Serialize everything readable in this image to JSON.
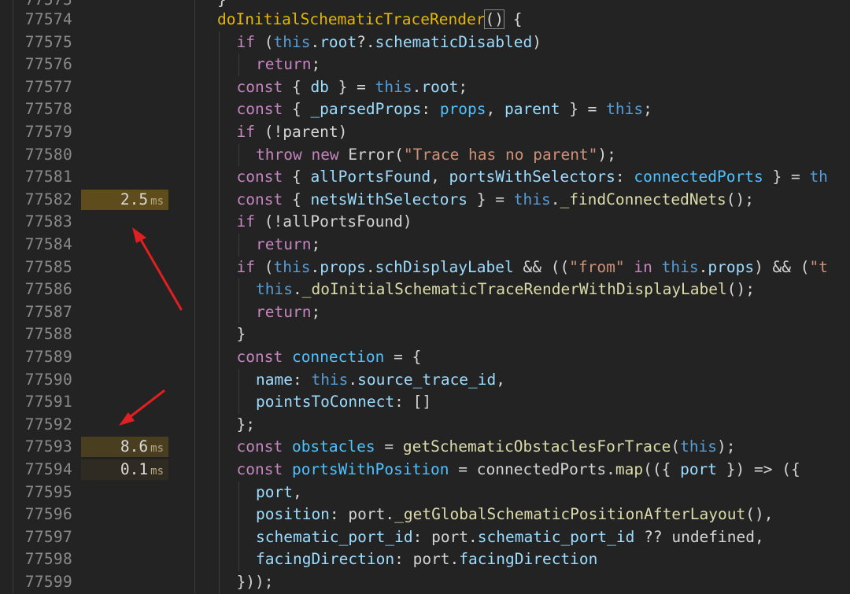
{
  "editor": {
    "top_partial_line_number": "77573",
    "lines": [
      {
        "n": "77574",
        "timing": null,
        "indent": 0,
        "tokens": [
          [
            "t-fnyellow",
            "doInitialSchematicTraceRender"
          ],
          [
            "t-plain cursor-box",
            "()"
          ],
          [
            "t-plain",
            " {"
          ]
        ]
      },
      {
        "n": "77575",
        "timing": null,
        "indent": 1,
        "tokens": [
          [
            "t-kw",
            "if"
          ],
          [
            "t-plain",
            " ("
          ],
          [
            "t-this",
            "this"
          ],
          [
            "t-plain",
            "."
          ],
          [
            "t-var",
            "root"
          ],
          [
            "t-plain",
            "?."
          ],
          [
            "t-var",
            "schematicDisabled"
          ],
          [
            "t-plain",
            ")"
          ]
        ]
      },
      {
        "n": "77576",
        "timing": null,
        "indent": 2,
        "tokens": [
          [
            "t-kw",
            "return"
          ],
          [
            "t-plain",
            ";"
          ]
        ]
      },
      {
        "n": "77577",
        "timing": null,
        "indent": 1,
        "tokens": [
          [
            "t-kw",
            "const"
          ],
          [
            "t-plain",
            " { "
          ],
          [
            "t-var",
            "db"
          ],
          [
            "t-plain",
            " } = "
          ],
          [
            "t-this",
            "this"
          ],
          [
            "t-plain",
            "."
          ],
          [
            "t-var",
            "root"
          ],
          [
            "t-plain",
            ";"
          ]
        ]
      },
      {
        "n": "77578",
        "timing": null,
        "indent": 1,
        "tokens": [
          [
            "t-kw",
            "const"
          ],
          [
            "t-plain",
            " { "
          ],
          [
            "t-var",
            "_parsedProps"
          ],
          [
            "t-plain",
            ": "
          ],
          [
            "t-const",
            "props"
          ],
          [
            "t-plain",
            ", "
          ],
          [
            "t-var",
            "parent"
          ],
          [
            "t-plain",
            " } = "
          ],
          [
            "t-this",
            "this"
          ],
          [
            "t-plain",
            ";"
          ]
        ]
      },
      {
        "n": "77579",
        "timing": null,
        "indent": 1,
        "tokens": [
          [
            "t-kw",
            "if"
          ],
          [
            "t-plain",
            " (!parent)"
          ]
        ]
      },
      {
        "n": "77580",
        "timing": null,
        "indent": 2,
        "tokens": [
          [
            "t-kw",
            "throw"
          ],
          [
            "t-plain",
            " "
          ],
          [
            "t-kw",
            "new"
          ],
          [
            "t-plain",
            " Error("
          ],
          [
            "t-str",
            "\"Trace has no parent\""
          ],
          [
            "t-plain",
            ");"
          ]
        ]
      },
      {
        "n": "77581",
        "timing": null,
        "indent": 1,
        "tokens": [
          [
            "t-kw",
            "const"
          ],
          [
            "t-plain",
            " { "
          ],
          [
            "t-var",
            "allPortsFound"
          ],
          [
            "t-plain",
            ", "
          ],
          [
            "t-var",
            "portsWithSelectors"
          ],
          [
            "t-plain",
            ": "
          ],
          [
            "t-const",
            "connectedPorts"
          ],
          [
            "t-plain",
            " } = "
          ],
          [
            "t-this",
            "th"
          ]
        ]
      },
      {
        "n": "77582",
        "timing": {
          "value": "2.5",
          "unit": "ms",
          "level": "hot"
        },
        "indent": 1,
        "tokens": [
          [
            "t-kw",
            "const"
          ],
          [
            "t-plain",
            " { "
          ],
          [
            "t-var",
            "netsWithSelectors"
          ],
          [
            "t-plain",
            " } = "
          ],
          [
            "t-this",
            "this"
          ],
          [
            "t-plain",
            "."
          ],
          [
            "t-fn",
            "_findConnectedNets"
          ],
          [
            "t-plain",
            "();"
          ]
        ]
      },
      {
        "n": "77583",
        "timing": null,
        "indent": 1,
        "tokens": [
          [
            "t-kw",
            "if"
          ],
          [
            "t-plain",
            " (!allPortsFound)"
          ]
        ]
      },
      {
        "n": "77584",
        "timing": null,
        "indent": 2,
        "tokens": [
          [
            "t-kw",
            "return"
          ],
          [
            "t-plain",
            ";"
          ]
        ]
      },
      {
        "n": "77585",
        "timing": null,
        "indent": 1,
        "tokens": [
          [
            "t-kw",
            "if"
          ],
          [
            "t-plain",
            " ("
          ],
          [
            "t-this",
            "this"
          ],
          [
            "t-plain",
            "."
          ],
          [
            "t-var",
            "props"
          ],
          [
            "t-plain",
            "."
          ],
          [
            "t-var",
            "schDisplayLabel"
          ],
          [
            "t-plain",
            " && (("
          ],
          [
            "t-str",
            "\"from\""
          ],
          [
            "t-plain",
            " "
          ],
          [
            "t-kw",
            "in"
          ],
          [
            "t-plain",
            " "
          ],
          [
            "t-this",
            "this"
          ],
          [
            "t-plain",
            "."
          ],
          [
            "t-var",
            "props"
          ],
          [
            "t-plain",
            ") && ("
          ],
          [
            "t-str",
            "\"t"
          ]
        ]
      },
      {
        "n": "77586",
        "timing": null,
        "indent": 2,
        "tokens": [
          [
            "t-this",
            "this"
          ],
          [
            "t-plain",
            "."
          ],
          [
            "t-fn",
            "_doInitialSchematicTraceRenderWithDisplayLabel"
          ],
          [
            "t-plain",
            "();"
          ]
        ]
      },
      {
        "n": "77587",
        "timing": null,
        "indent": 2,
        "tokens": [
          [
            "t-kw",
            "return"
          ],
          [
            "t-plain",
            ";"
          ]
        ]
      },
      {
        "n": "77588",
        "timing": null,
        "indent": 1,
        "tokens": [
          [
            "t-plain",
            "}"
          ]
        ]
      },
      {
        "n": "77589",
        "timing": null,
        "indent": 1,
        "tokens": [
          [
            "t-kw",
            "const"
          ],
          [
            "t-plain",
            " "
          ],
          [
            "t-const",
            "connection"
          ],
          [
            "t-plain",
            " = {"
          ]
        ]
      },
      {
        "n": "77590",
        "timing": null,
        "indent": 2,
        "tokens": [
          [
            "t-var",
            "name"
          ],
          [
            "t-plain",
            ": "
          ],
          [
            "t-this",
            "this"
          ],
          [
            "t-plain",
            "."
          ],
          [
            "t-var",
            "source_trace_id"
          ],
          [
            "t-plain",
            ","
          ]
        ]
      },
      {
        "n": "77591",
        "timing": null,
        "indent": 2,
        "tokens": [
          [
            "t-var",
            "pointsToConnect"
          ],
          [
            "t-plain",
            ": []"
          ]
        ]
      },
      {
        "n": "77592",
        "timing": null,
        "indent": 1,
        "tokens": [
          [
            "t-plain",
            "};"
          ]
        ]
      },
      {
        "n": "77593",
        "timing": {
          "value": "8.6",
          "unit": "ms",
          "level": "warm"
        },
        "indent": 1,
        "tokens": [
          [
            "t-kw",
            "const"
          ],
          [
            "t-plain",
            " "
          ],
          [
            "t-const",
            "obstacles"
          ],
          [
            "t-plain",
            " = "
          ],
          [
            "t-fn",
            "getSchematicObstaclesForTrace"
          ],
          [
            "t-plain",
            "("
          ],
          [
            "t-this",
            "this"
          ],
          [
            "t-plain",
            ");"
          ]
        ]
      },
      {
        "n": "77594",
        "timing": {
          "value": "0.1",
          "unit": "ms",
          "level": "cool"
        },
        "indent": 1,
        "tokens": [
          [
            "t-kw",
            "const"
          ],
          [
            "t-plain",
            " "
          ],
          [
            "t-const",
            "portsWithPosition"
          ],
          [
            "t-plain",
            " = connectedPorts."
          ],
          [
            "t-fn",
            "map"
          ],
          [
            "t-plain",
            "(({ "
          ],
          [
            "t-var",
            "port"
          ],
          [
            "t-plain",
            " }) => ({"
          ]
        ]
      },
      {
        "n": "77595",
        "timing": null,
        "indent": 2,
        "tokens": [
          [
            "t-var",
            "port"
          ],
          [
            "t-plain",
            ","
          ]
        ]
      },
      {
        "n": "77596",
        "timing": null,
        "indent": 2,
        "tokens": [
          [
            "t-var",
            "position"
          ],
          [
            "t-plain",
            ": port."
          ],
          [
            "t-fn",
            "_getGlobalSchematicPositionAfterLayout"
          ],
          [
            "t-plain",
            "(),"
          ]
        ]
      },
      {
        "n": "77597",
        "timing": null,
        "indent": 2,
        "tokens": [
          [
            "t-var",
            "schematic_port_id"
          ],
          [
            "t-plain",
            ": port."
          ],
          [
            "t-var",
            "schematic_port_id"
          ],
          [
            "t-plain",
            " ?? undefined,"
          ]
        ]
      },
      {
        "n": "77598",
        "timing": null,
        "indent": 2,
        "tokens": [
          [
            "t-var",
            "facingDirection"
          ],
          [
            "t-plain",
            ": port."
          ],
          [
            "t-var",
            "facingDirection"
          ]
        ]
      },
      {
        "n": "77599",
        "timing": null,
        "indent": 1,
        "tokens": [
          [
            "t-plain",
            "}));"
          ]
        ]
      }
    ]
  },
  "annotations": {
    "arrow_color": "#e02020",
    "arrows": [
      {
        "name": "arrow-to-77582-timing"
      },
      {
        "name": "arrow-to-77593-timing"
      }
    ]
  }
}
